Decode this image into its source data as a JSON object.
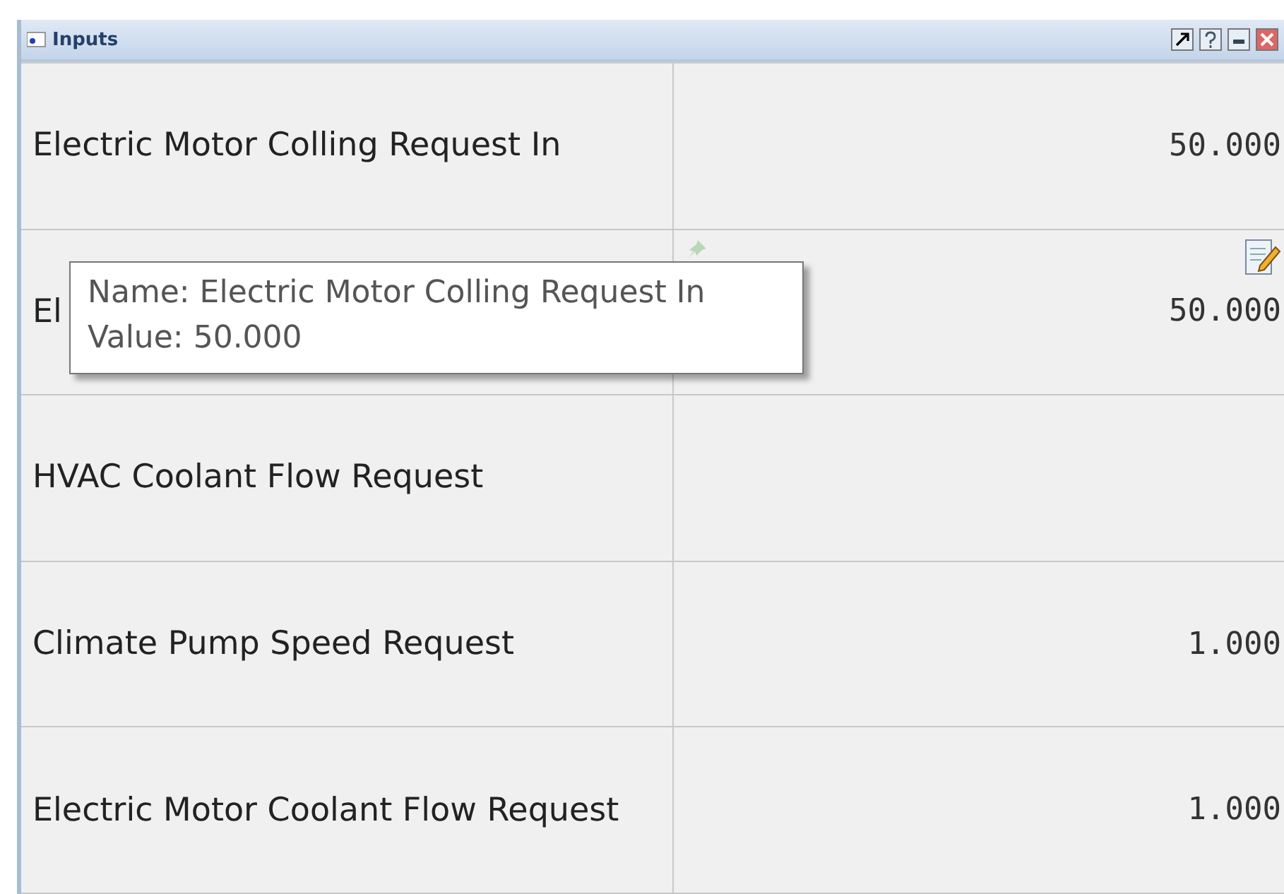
{
  "window": {
    "title": "Inputs"
  },
  "rows": [
    {
      "name": "Electric Motor Colling Request In",
      "value": "50.000",
      "editable": false
    },
    {
      "name": "El",
      "value": "50.000",
      "editable": true
    },
    {
      "name": "HVAC Coolant Flow Request",
      "editable": false
    },
    {
      "name": "Climate Pump Speed Request",
      "value": "1.000",
      "editable": false
    },
    {
      "name": "Electric Motor Coolant Flow Request",
      "value": "1.000",
      "editable": false
    }
  ],
  "tooltip": {
    "lines": [
      "Name: Electric Motor Colling Request In",
      "Value: 50.000"
    ]
  }
}
